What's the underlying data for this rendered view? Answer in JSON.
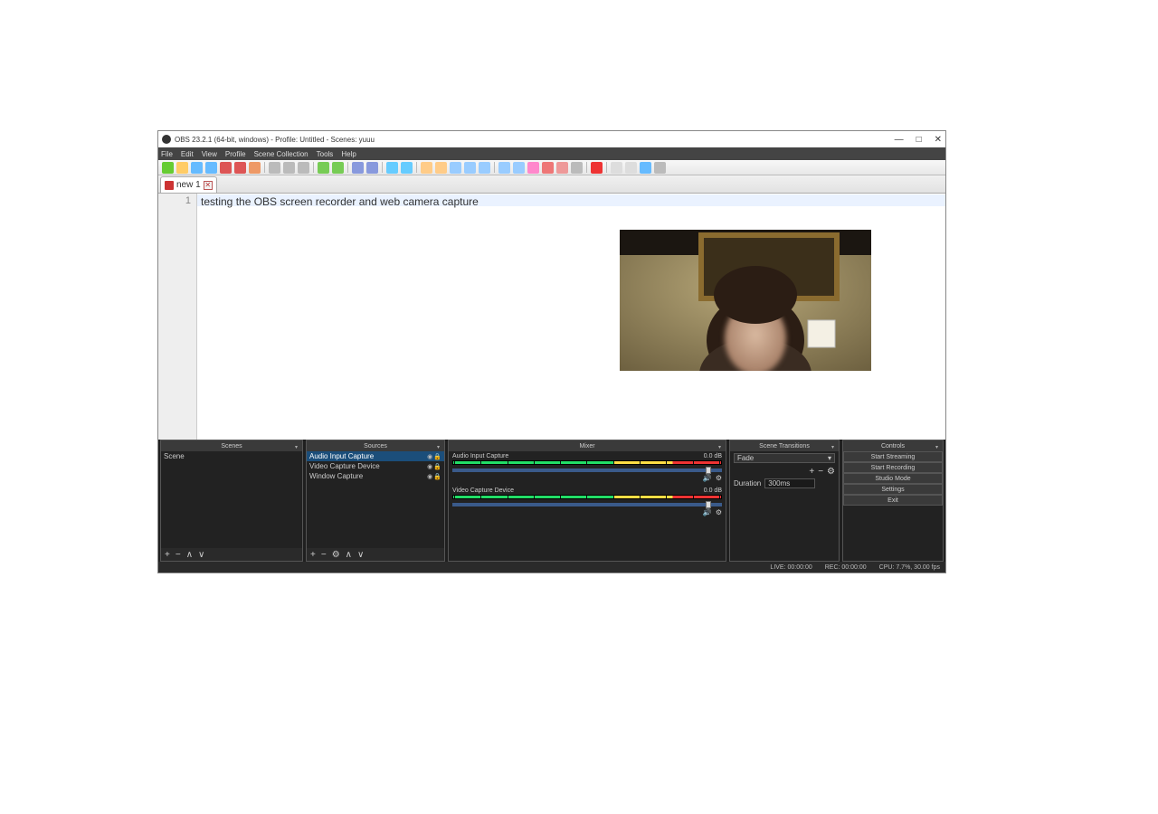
{
  "window": {
    "title": "OBS 23.2.1 (64-bit, windows) - Profile: Untitled - Scenes: yuuu",
    "minimize": "—",
    "maximize": "□",
    "close": "✕"
  },
  "menu": [
    "File",
    "Edit",
    "View",
    "Profile",
    "Scene Collection",
    "Tools",
    "Help"
  ],
  "tab": {
    "name": "new 1",
    "close": "✕"
  },
  "editor": {
    "line_no": "1",
    "text": "testing the OBS screen recorder and web camera capture"
  },
  "docks": {
    "scenes": {
      "title": "Scenes",
      "items": [
        "Scene"
      ]
    },
    "sources": {
      "title": "Sources",
      "items": [
        "Audio Input Capture",
        "Video Capture Device",
        "Window Capture"
      ],
      "selected_index": 0
    },
    "mixer": {
      "title": "Mixer",
      "channels": [
        {
          "name": "Audio Input Capture",
          "level": "0.0 dB"
        },
        {
          "name": "Video Capture Device",
          "level": "0.0 dB"
        }
      ]
    },
    "transitions": {
      "title": "Scene Transitions",
      "selected": "Fade",
      "duration_label": "Duration",
      "duration_value": "300ms"
    },
    "controls": {
      "title": "Controls",
      "buttons": [
        "Start Streaming",
        "Start Recording",
        "Studio Mode",
        "Settings",
        "Exit"
      ]
    }
  },
  "statusbar": {
    "live": "LIVE: 00:00:00",
    "rec": "REC: 00:00:00",
    "cpu": "CPU: 7.7%, 30.00 fps"
  },
  "icons": {
    "plus": "+",
    "minus": "−",
    "gear": "⚙",
    "up": "∧",
    "down": "∨",
    "eye": "◉",
    "lock": "🔒",
    "speaker": "🔊",
    "chev": "▾"
  }
}
